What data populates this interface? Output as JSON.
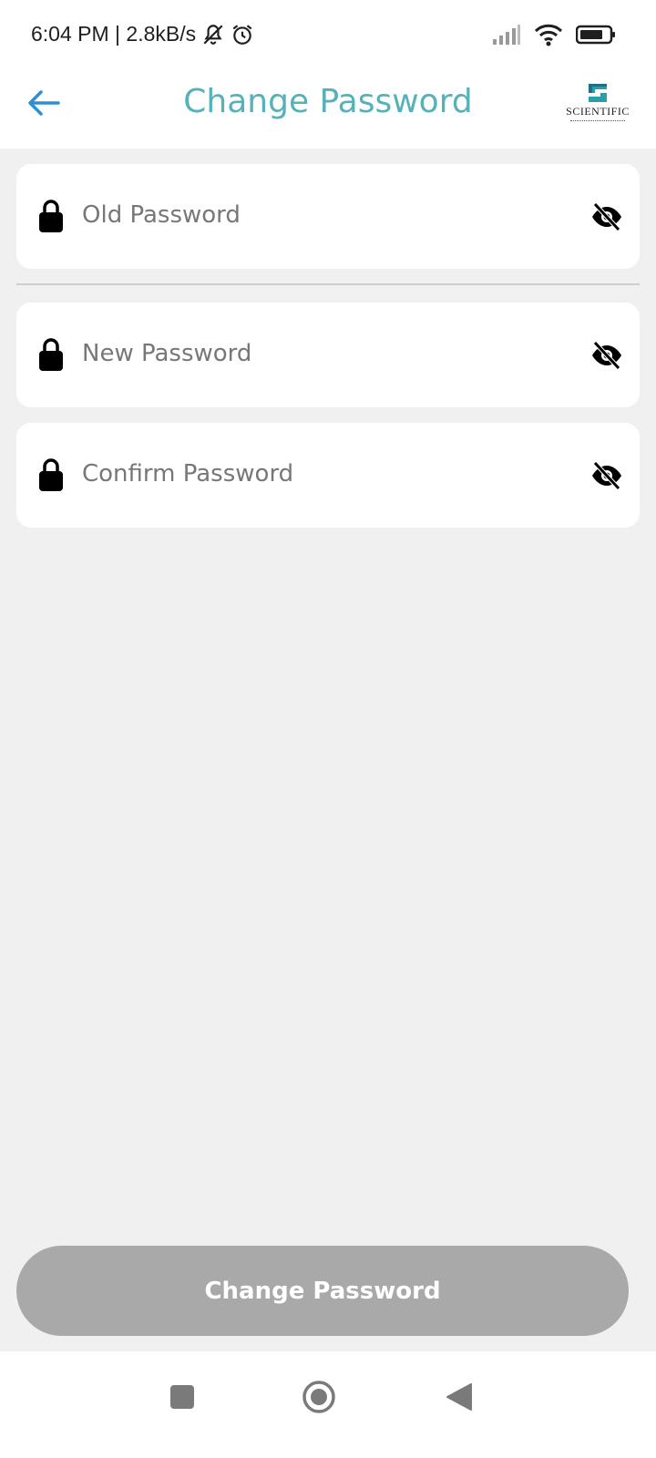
{
  "status_bar": {
    "time_speed": "6:04 PM | 2.8kB/s",
    "icons": [
      "bell-off-icon",
      "alarm-icon",
      "signal-icon",
      "wifi-icon",
      "battery-icon"
    ]
  },
  "header": {
    "title": "Change Password",
    "back_icon": "arrow-left-icon",
    "logo_text": "SCIENTIFIC",
    "title_color": "#55b2b8",
    "back_color": "#2f8fd0"
  },
  "form": {
    "old_password": {
      "placeholder": "Old Password",
      "value": ""
    },
    "new_password": {
      "placeholder": "New Password",
      "value": ""
    },
    "confirm_password": {
      "placeholder": "Confirm Password",
      "value": ""
    }
  },
  "submit": {
    "label": "Change Password",
    "color": "#a9a9a9"
  },
  "nav": {
    "icons": [
      "recents-square-icon",
      "home-circle-icon",
      "back-triangle-icon"
    ]
  }
}
